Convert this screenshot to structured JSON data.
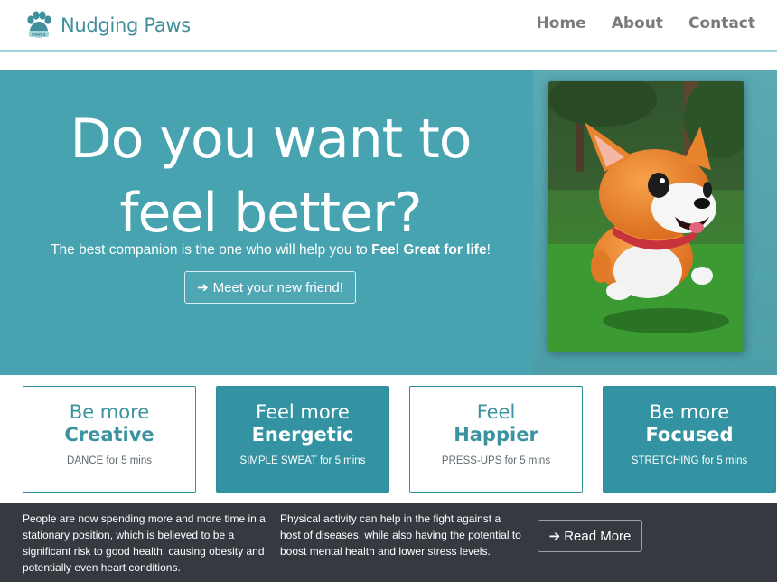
{
  "brand": {
    "name": "Nudging Paws",
    "logo_text": "PAWS"
  },
  "nav": {
    "items": [
      "Home",
      "About",
      "Contact"
    ]
  },
  "hero": {
    "title": "Do you want to feel better?",
    "subtitle_pre": "The best companion is the one who will help you to ",
    "subtitle_bold": "Feel Great for life",
    "subtitle_post": "!",
    "cta_arrow": "➔",
    "cta_label": "Meet your new friend!"
  },
  "cards": [
    {
      "line1": "Be more",
      "line2": "Creative",
      "sub": "DANCE for 5 mins",
      "style": "light"
    },
    {
      "line1": "Feel more",
      "line2": "Energetic",
      "sub": "SIMPLE SWEAT for 5 mins",
      "style": "dark"
    },
    {
      "line1": "Feel",
      "line2": "Happier",
      "sub": "PRESS-UPS for 5 mins",
      "style": "light"
    },
    {
      "line1": "Be more",
      "line2": "Focused",
      "sub": "STRETCHING for 5 mins",
      "style": "dark"
    }
  ],
  "footer": {
    "p1": "People are now spending more and more time in a stationary position, which is believed to be a significant risk to good health, causing obesity and potentially even heart conditions.",
    "p2": "Physical activity can help in the fight against a host of diseases, while also having the potential to boost mental health and lower stress levels.",
    "read_arrow": "➔",
    "read_label": "Read More"
  },
  "colors": {
    "brand": "#3f8f9c",
    "hero_bg": "#47a3b0",
    "card_dark": "#3493a2",
    "footer_bg": "#363a40"
  },
  "icons": {
    "logo": "paw-icon",
    "cta": "arrow-right-icon"
  }
}
